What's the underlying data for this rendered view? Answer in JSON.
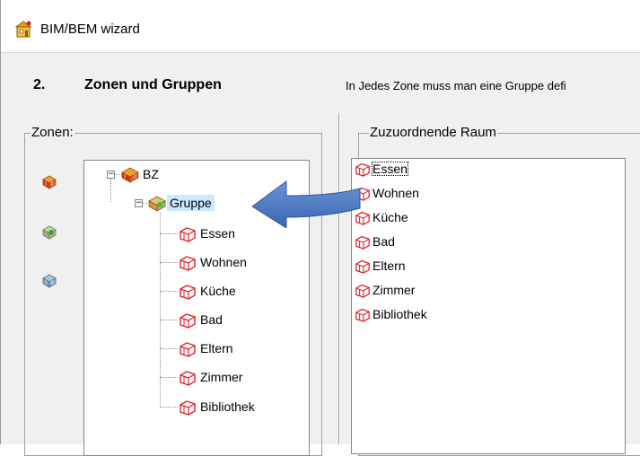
{
  "window": {
    "title": "BIM/BEM wizard"
  },
  "step": {
    "number": "2.",
    "title": "Zonen und Gruppen",
    "description": "In Jedes Zone muss man eine Gruppe defi"
  },
  "zonen": {
    "legend": "Zonen:",
    "toolbar": [
      "zone-add-icon",
      "group-add-icon",
      "room-add-icon"
    ],
    "tree": {
      "root": "BZ",
      "group": "Gruppe",
      "rooms": [
        "Essen",
        "Wohnen",
        "Küche",
        "Bad",
        "Eltern",
        "Zimmer",
        "Bibliothek"
      ]
    }
  },
  "raum": {
    "legend": "Zuzuordnende Raum",
    "items": [
      "Essen",
      "Wohnen",
      "Küche",
      "Bad",
      "Eltern",
      "Zimmer",
      "Bibliothek"
    ]
  },
  "colors": {
    "arrow": "#4a79c4",
    "selection": "#cce8ff",
    "room_icon": "#e0202a"
  }
}
